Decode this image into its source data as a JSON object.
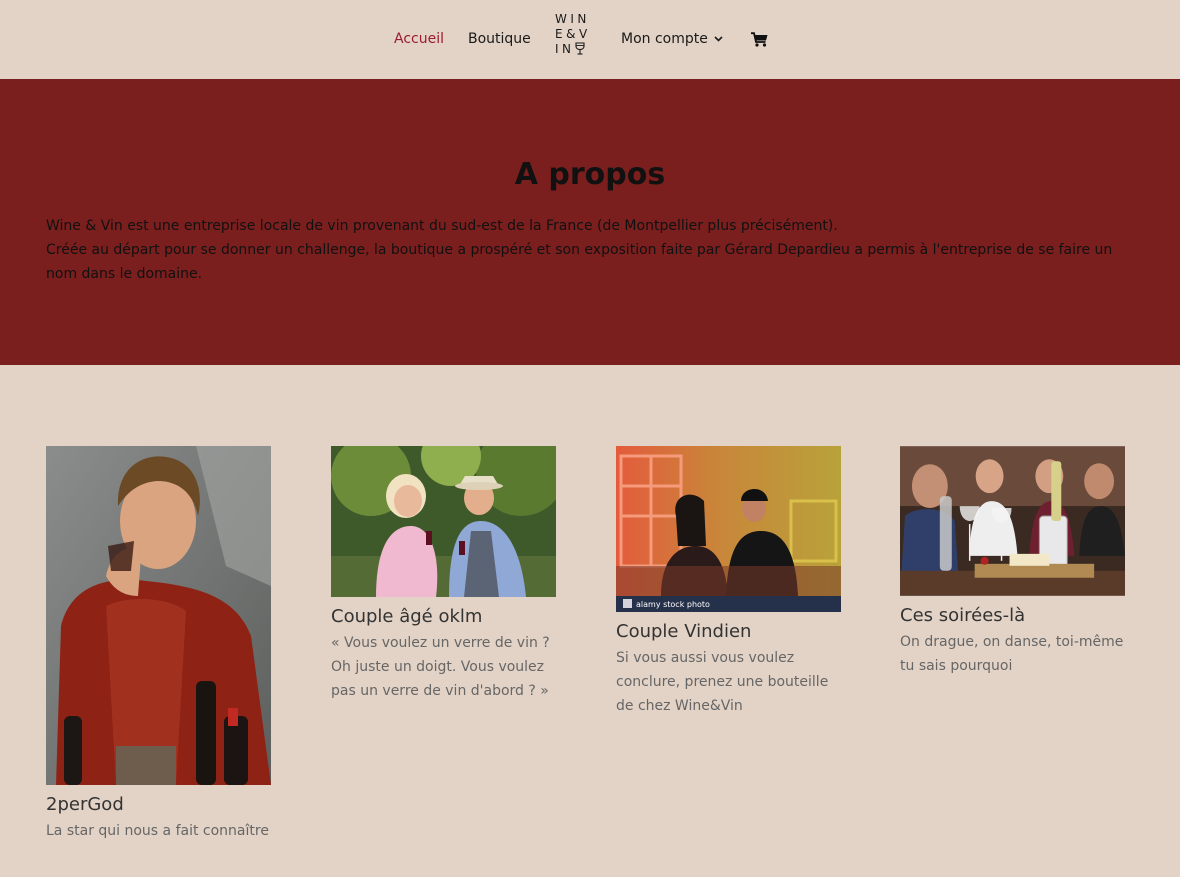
{
  "nav": {
    "home": "Accueil",
    "shop": "Boutique",
    "account": "Mon compte",
    "logo_lines": [
      "WIN",
      "E&V",
      "IN"
    ],
    "active_color": "#9b1b30",
    "icons": [
      "chevron-down-icon",
      "cart-icon",
      "wine-glass-icon"
    ]
  },
  "hero": {
    "title": "A propos",
    "paragraph1": "Wine & Vin est une entreprise locale de vin provenant du sud-est de la France (de Montpellier plus précisément).",
    "paragraph2": "Créée au départ pour se donner un challenge, la boutique a prospéré et son exposition faite par Gérard Depardieu a permis à l'entreprise de se faire un nom dans le domaine.",
    "background": "#7b1e1e"
  },
  "cards": [
    {
      "title": "2perGod",
      "description": "La star qui nous a fait connaître"
    },
    {
      "title": "Couple âgé oklm",
      "description": "« Vous voulez un verre de vin ? Oh juste un doigt. Vous voulez pas un verre de vin d'abord ? »"
    },
    {
      "title": "Couple Vindien",
      "description": "Si vous aussi vous voulez conclure, prenez une bouteille de chez Wine&Vin",
      "watermark": "alamy stock photo"
    },
    {
      "title": "Ces soirées-là",
      "description": "On drague, on danse, toi-même tu sais pourquoi"
    }
  ],
  "colors": {
    "page_bg": "#e3d3c6",
    "hero_bg": "#7b1e1e",
    "text_muted": "#666666"
  }
}
